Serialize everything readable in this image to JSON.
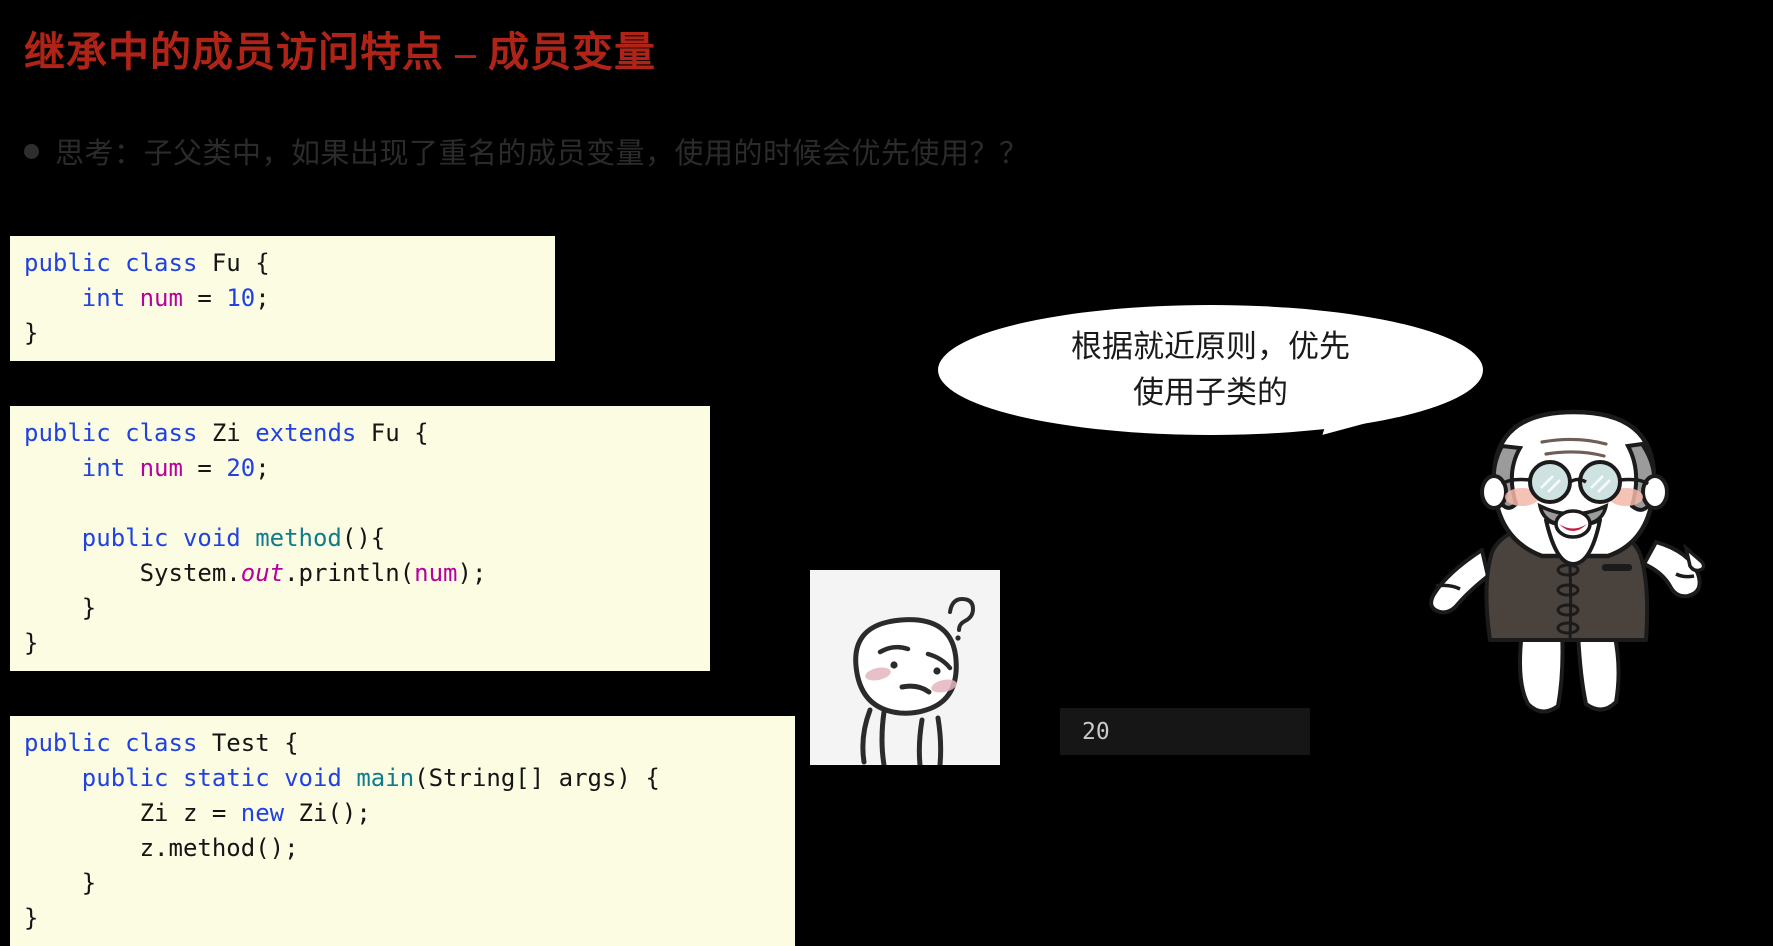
{
  "slide": {
    "title": "继承中的成员访问特点 – 成员变量",
    "bullet": {
      "icon": "bullet-dot",
      "text": "思考：子父类中，如果出现了重名的成员变量，使用的时候会优先使用？？"
    }
  },
  "code_blocks": [
    {
      "name": "Fu",
      "lines": [
        [
          {
            "t": "public class ",
            "c": "kw"
          },
          {
            "t": "Fu {",
            "c": "pln"
          }
        ],
        [
          {
            "t": "    ",
            "c": "pln"
          },
          {
            "t": "int ",
            "c": "kw"
          },
          {
            "t": "num",
            "c": "fld"
          },
          {
            "t": " = ",
            "c": "pln"
          },
          {
            "t": "10",
            "c": "num"
          },
          {
            "t": ";",
            "c": "pln"
          }
        ],
        [
          {
            "t": "}",
            "c": "pln"
          }
        ]
      ]
    },
    {
      "name": "Zi",
      "lines": [
        [
          {
            "t": "public class ",
            "c": "kw"
          },
          {
            "t": "Zi ",
            "c": "pln"
          },
          {
            "t": "extends ",
            "c": "kw"
          },
          {
            "t": "Fu {",
            "c": "pln"
          }
        ],
        [
          {
            "t": "    ",
            "c": "pln"
          },
          {
            "t": "int ",
            "c": "kw"
          },
          {
            "t": "num",
            "c": "fld"
          },
          {
            "t": " = ",
            "c": "pln"
          },
          {
            "t": "20",
            "c": "num"
          },
          {
            "t": ";",
            "c": "pln"
          }
        ],
        [
          {
            "t": " ",
            "c": "pln"
          }
        ],
        [
          {
            "t": "    ",
            "c": "pln"
          },
          {
            "t": "public void ",
            "c": "kw"
          },
          {
            "t": "method",
            "c": "mth"
          },
          {
            "t": "(){",
            "c": "pln"
          }
        ],
        [
          {
            "t": "        System.",
            "c": "pln"
          },
          {
            "t": "out",
            "c": "fldi"
          },
          {
            "t": ".println(",
            "c": "pln"
          },
          {
            "t": "num",
            "c": "fld"
          },
          {
            "t": ");",
            "c": "pln"
          }
        ],
        [
          {
            "t": "    }",
            "c": "pln"
          }
        ],
        [
          {
            "t": "}",
            "c": "pln"
          }
        ]
      ]
    },
    {
      "name": "Test",
      "lines": [
        [
          {
            "t": "public class ",
            "c": "kw"
          },
          {
            "t": "Test {",
            "c": "pln"
          }
        ],
        [
          {
            "t": "    ",
            "c": "pln"
          },
          {
            "t": "public static void ",
            "c": "kw"
          },
          {
            "t": "main",
            "c": "mth"
          },
          {
            "t": "(String[] args) {",
            "c": "pln"
          }
        ],
        [
          {
            "t": "        Zi z = ",
            "c": "pln"
          },
          {
            "t": "new ",
            "c": "kw"
          },
          {
            "t": "Zi();",
            "c": "pln"
          }
        ],
        [
          {
            "t": "        z.method();",
            "c": "pln"
          }
        ],
        [
          {
            "t": "    }",
            "c": "pln"
          }
        ],
        [
          {
            "t": "}",
            "c": "pln"
          }
        ]
      ]
    }
  ],
  "speech_bubble": {
    "line1": "根据就近原则，优先",
    "line2": "使用子类的"
  },
  "console": {
    "value": "20"
  },
  "sticker": {
    "label": "thinking-face-sticker",
    "question_mark": "?"
  },
  "character": {
    "label": "elderly-master-character"
  },
  "colors": {
    "background": "#000000",
    "title": "#B02418",
    "bullet_text": "#2B2B2B",
    "code_background": "#FCFCE2",
    "keyword": "#2042E0",
    "field": "#B7009E",
    "method": "#0E7C8C",
    "console_background": "#161616",
    "console_text": "#C9C9C9",
    "bubble": "#FFFFFF",
    "jacket": "#4A423C"
  }
}
